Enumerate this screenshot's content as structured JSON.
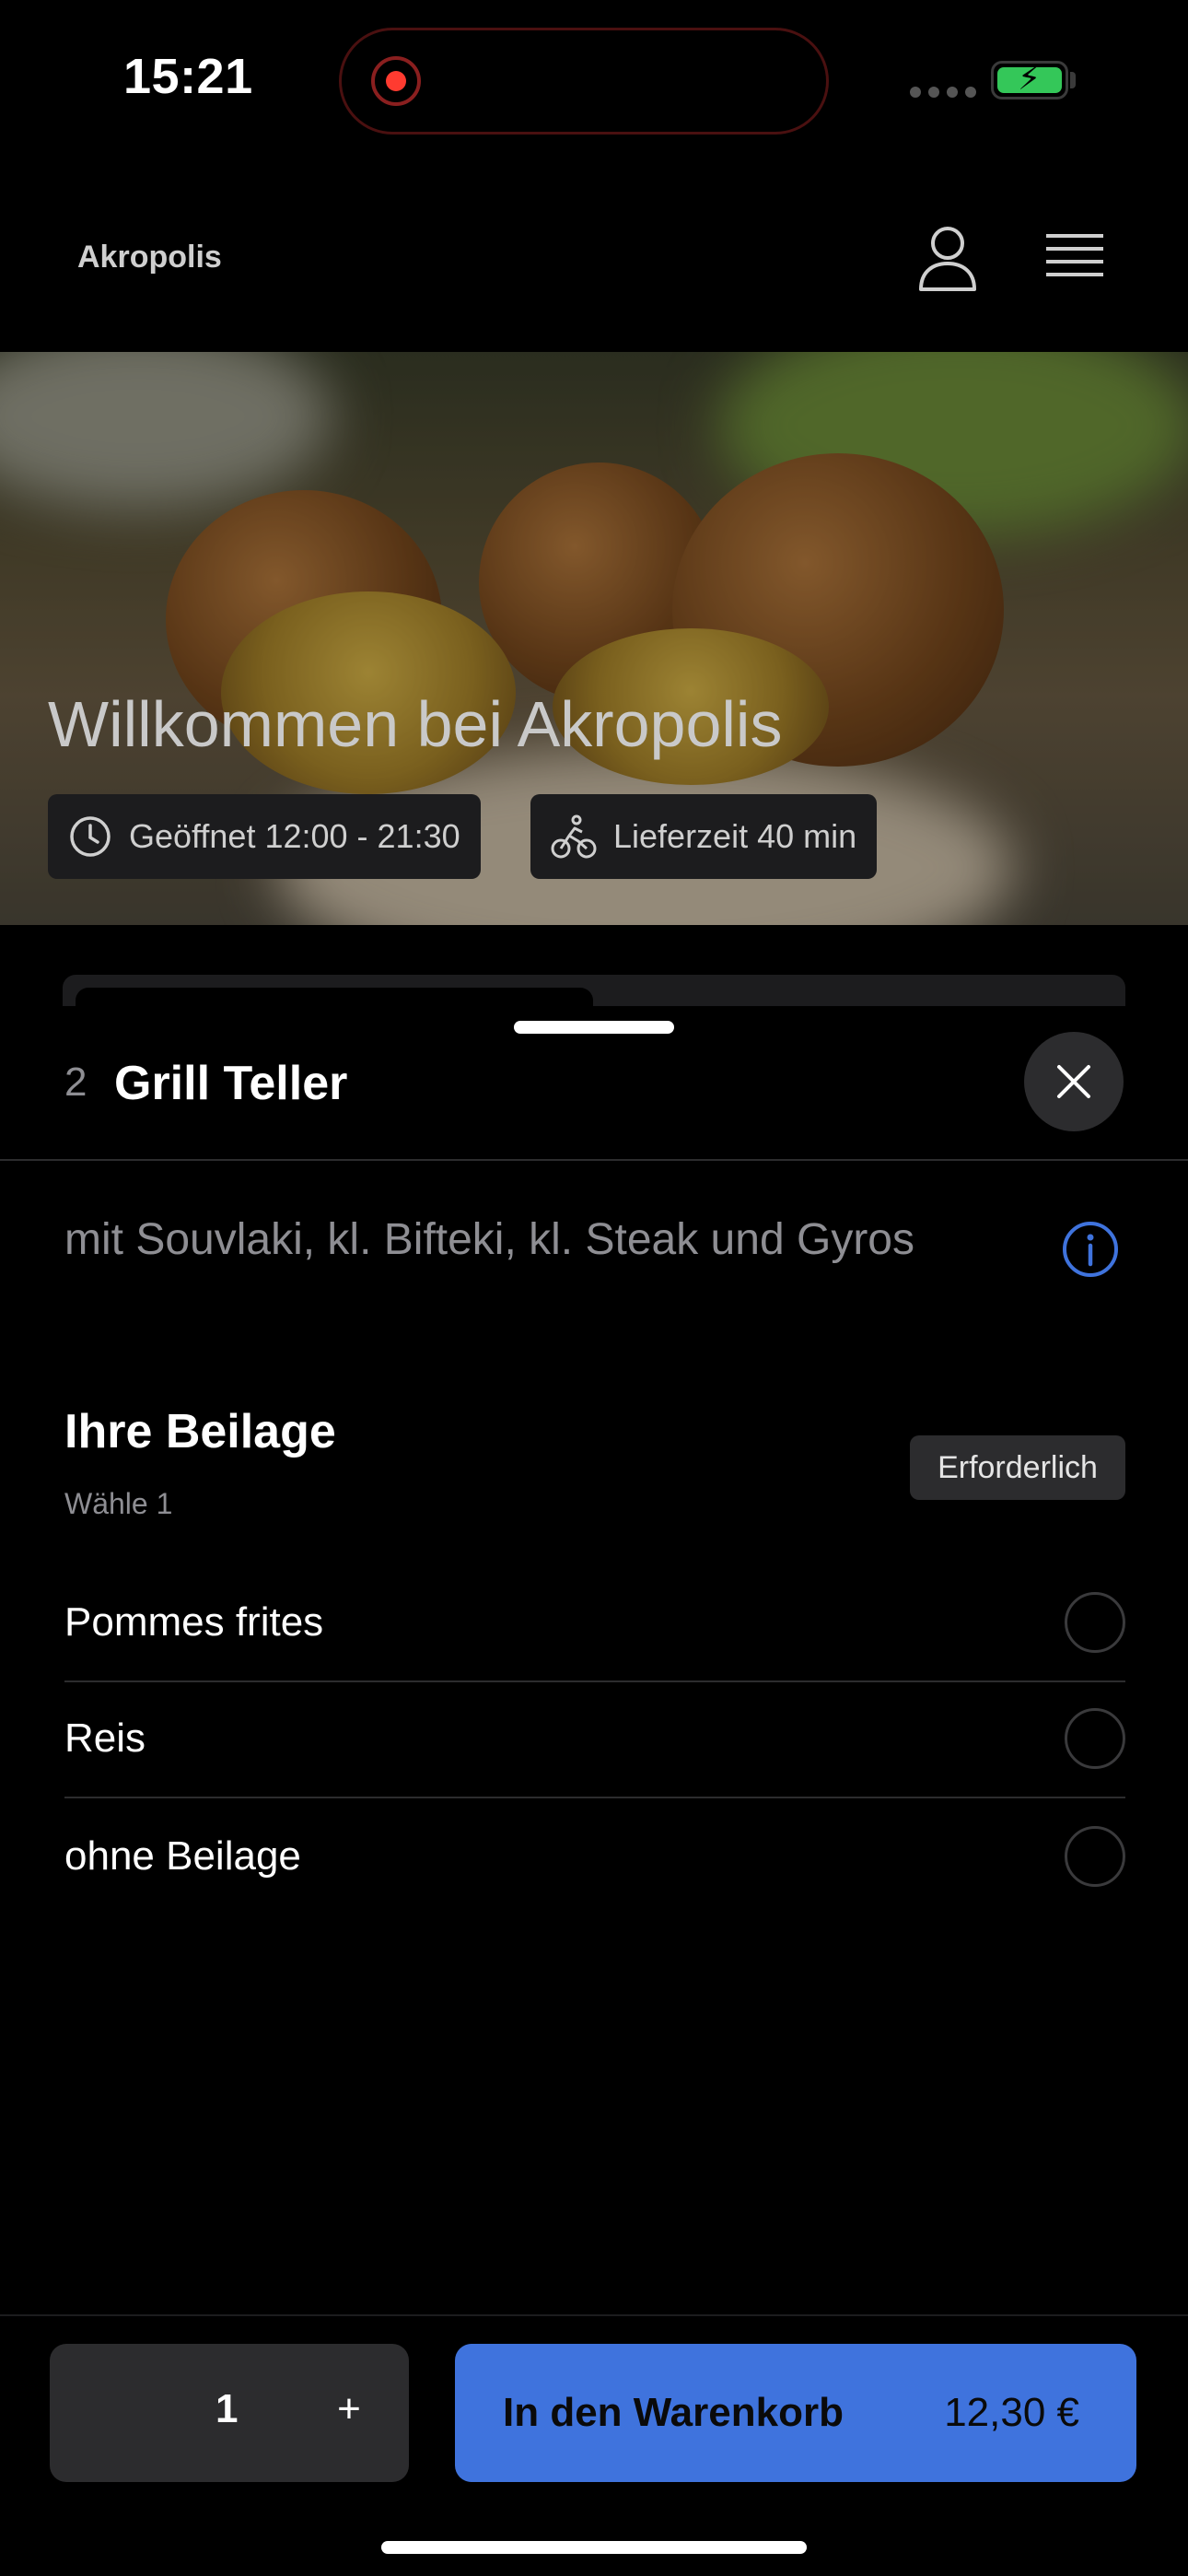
{
  "status_bar": {
    "time": "15:21"
  },
  "header": {
    "brand": "Akropolis",
    "icons": [
      "user-icon",
      "menu-icon"
    ]
  },
  "hero": {
    "title": "Willkommen bei Akropolis",
    "opening_hours": "Geöffnet 12:00 - 21:30",
    "delivery_time": "Lieferzeit 40 min",
    "icons": [
      "clock-icon",
      "bicycle-icon"
    ]
  },
  "item": {
    "number": "2",
    "title": "Grill Teller",
    "description": "mit Souvlaki, kl. Bifteki, kl. Steak und Gyros"
  },
  "options_group": {
    "title": "Ihre Beilage",
    "subtitle": "Wähle 1",
    "badge": "Erforderlich",
    "items": [
      {
        "label": "Pommes frites",
        "selected": false
      },
      {
        "label": "Reis",
        "selected": false
      },
      {
        "label": "ohne Beilage",
        "selected": false
      }
    ]
  },
  "footer": {
    "quantity": "1",
    "plus": "+",
    "add_to_cart": "In den Warenkorb",
    "price": "12,30 €"
  },
  "colors": {
    "accent": "#3f73dd",
    "background": "#000000",
    "surface": "#2c2c2e",
    "battery": "#34c759"
  }
}
